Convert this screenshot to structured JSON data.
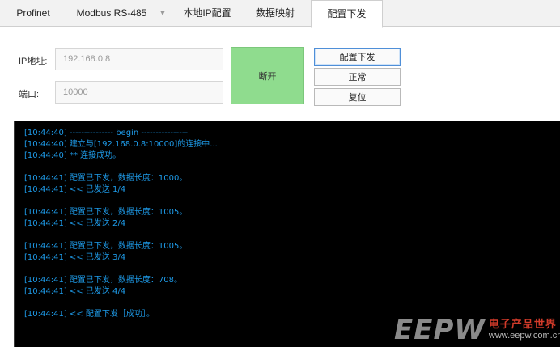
{
  "tabs": [
    {
      "label": "Profinet",
      "active": false
    },
    {
      "label": "Modbus RS-485",
      "active": false
    },
    {
      "label": "本地IP配置",
      "active": false
    },
    {
      "label": "数据映射",
      "active": false
    },
    {
      "label": "配置下发",
      "active": true
    }
  ],
  "icons": {
    "tab_dropdown": "▼"
  },
  "connection": {
    "ip_label": "IP地址:",
    "ip_value": "192.168.0.8",
    "port_label": "端口:",
    "port_value": "10000",
    "status_label": "断开",
    "status_color": "#8fdc8e"
  },
  "actions": {
    "deploy_label": "配置下发",
    "normal_label": "正常",
    "reset_label": "复位"
  },
  "console": {
    "text_color": "#1e9be9",
    "lines": [
      "[10:44:40] --------------- begin ----------------",
      "[10:44:40] 建立与[192.168.0.8:10000]的连接中...",
      "[10:44:40] ** 连接成功。",
      "",
      "[10:44:41] 配置已下发，数据长度：1000。",
      "[10:44:41] << 已发送 1/4",
      "",
      "[10:44:41] 配置已下发，数据长度：1005。",
      "[10:44:41] << 已发送 2/4",
      "",
      "[10:44:41] 配置已下发，数据长度：1005。",
      "[10:44:41] << 已发送 3/4",
      "",
      "[10:44:41] 配置已下发，数据长度：708。",
      "[10:44:41] << 已发送 4/4",
      "",
      "[10:44:41] << 配置下发［成功］。"
    ]
  },
  "watermark": {
    "logo": "EEPW",
    "cn_text": "电子产品世界",
    "url": "www.eepw.com.cn"
  }
}
